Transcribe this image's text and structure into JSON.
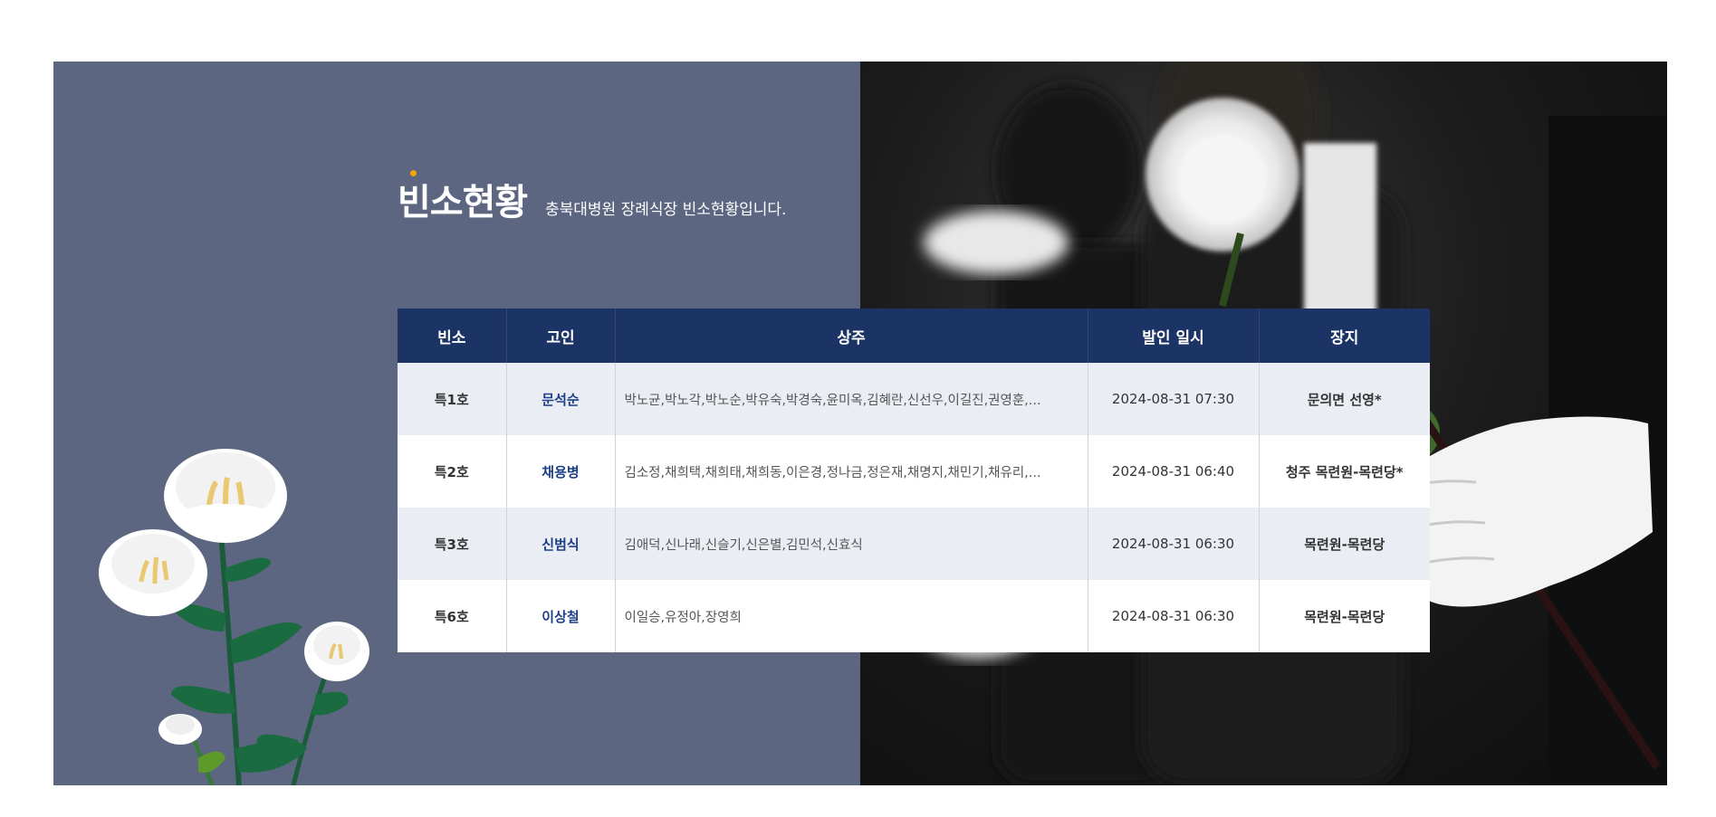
{
  "section": {
    "title": "빈소현황",
    "subtitle": "충북대병원 장례식장 빈소현황입니다."
  },
  "table": {
    "headers": [
      "빈소",
      "고인",
      "상주",
      "발인 일시",
      "장지"
    ],
    "rows": [
      {
        "room": "특1호",
        "deceased": "문석순",
        "mourners": "박노균,박노각,박노순,박유숙,박경숙,윤미옥,김혜란,신선우,이길진,권영훈,...",
        "date": "2024-08-31 07:30",
        "place": "문의면 선영*"
      },
      {
        "room": "특2호",
        "deceased": "채용병",
        "mourners": "김소정,채희택,채희태,채희동,이은경,정나금,정은재,채명지,채민기,채유리,...",
        "date": "2024-08-31 06:40",
        "place": "청주 목련원-목련당*"
      },
      {
        "room": "특3호",
        "deceased": "신범식",
        "mourners": "김애덕,신나래,신슬기,신은별,김민석,신효식",
        "date": "2024-08-31 06:30",
        "place": "목련원-목련당"
      },
      {
        "room": "특6호",
        "deceased": "이상철",
        "mourners": "이일승,유정아,장영희",
        "date": "2024-08-31 06:30",
        "place": "목련원-목련당"
      }
    ]
  },
  "colors": {
    "banner_bg": "#5c6680",
    "header_bg": "#1c3366",
    "row_alt_bg": "#eaeef4",
    "name_text": "#1b3f86",
    "accent_dot": "#f5a300"
  },
  "icons": {
    "decoration_left": "white-chrysanthemum-illustration",
    "photo_right": "mourners-holding-white-chrysanthemums-photo"
  }
}
